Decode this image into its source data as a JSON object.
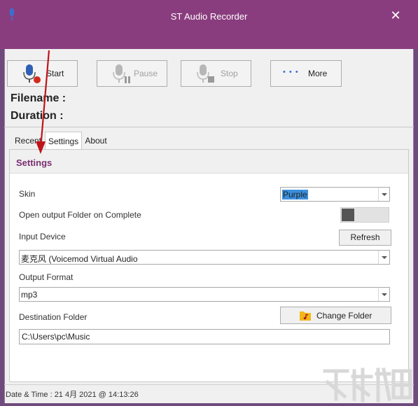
{
  "window": {
    "title": "ST Audio Recorder"
  },
  "toolbar": {
    "start_label": "Start",
    "pause_label": "Pause",
    "stop_label": "Stop",
    "more_label": "More",
    "more_dots": "• • •"
  },
  "info": {
    "filename_label": "Filename :",
    "duration_label": "Duration :"
  },
  "tabs": [
    {
      "label": "Recent",
      "active": false
    },
    {
      "label": "Settings",
      "active": true
    },
    {
      "label": "About",
      "active": false
    }
  ],
  "settings": {
    "title": "Settings",
    "skin_label": "Skin",
    "skin_value": "Purple",
    "open_folder_label": "Open output Folder on Complete",
    "open_folder_enabled": false,
    "input_device_label": "Input Device",
    "refresh_label": "Refresh",
    "input_device_value": "麦克风 (Voicemod Virtual Audio",
    "output_format_label": "Output Format",
    "output_format_value": "mp3",
    "destination_label": "Destination Folder",
    "change_folder_label": "Change Folder",
    "destination_value": "C:\\Users\\pc\\Music"
  },
  "status": {
    "text": "Date & Time : 21 4月 2021 @ 14:13:26"
  },
  "colors": {
    "titlebar": "#8a3d7e",
    "accent": "#7a2f73",
    "mic_icon": "#2f5fb5",
    "record_dot": "#d42a1c",
    "annotation_arrow": "#c0141a"
  },
  "icons": [
    "app-mic-icon",
    "close-icon",
    "mic-record-icon",
    "mic-pause-icon",
    "mic-stop-icon",
    "more-dots-icon",
    "dropdown-arrow-icon",
    "folder-music-icon"
  ]
}
